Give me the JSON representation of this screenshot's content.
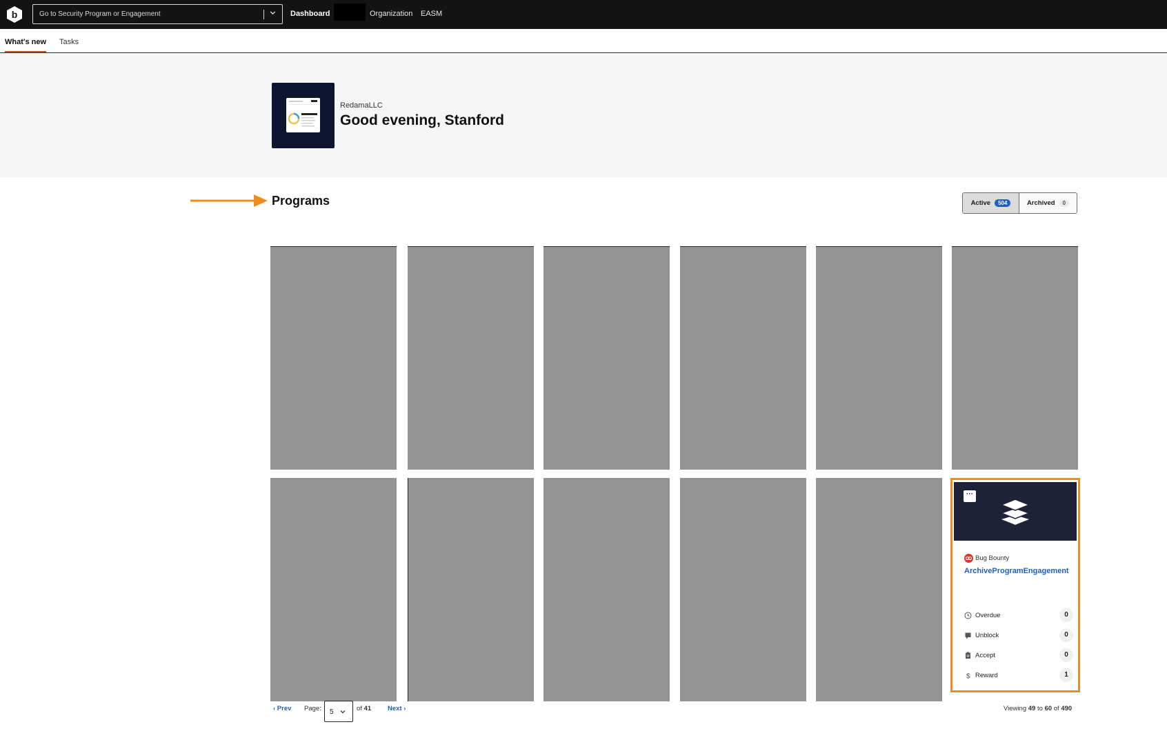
{
  "topnav": {
    "logo_letter": "b",
    "search_placeholder": "Go to Security Program or Engagement",
    "items": [
      {
        "label": "Dashboard",
        "active": true
      },
      {
        "label": "Organization",
        "active": false
      },
      {
        "label": "EASM",
        "active": false
      }
    ]
  },
  "subnav": {
    "tabs": [
      {
        "label": "What's new",
        "active": true
      },
      {
        "label": "Tasks",
        "active": false
      }
    ]
  },
  "hero": {
    "organization": "RedamaLLC",
    "greeting": "Good evening, Stanford"
  },
  "programs": {
    "title": "Programs",
    "filters": [
      {
        "label": "Active",
        "count": "504",
        "active": true
      },
      {
        "label": "Archived",
        "count": "0",
        "active": false
      }
    ],
    "highlighted_card": {
      "more_label": "···",
      "type_label": "Bug Bounty",
      "name": "ArchiveProgramEngagement",
      "metrics": [
        {
          "label": "Overdue",
          "count": "0",
          "icon": "clock-icon"
        },
        {
          "label": "Unblock",
          "count": "0",
          "icon": "unblock-icon"
        },
        {
          "label": "Accept",
          "count": "0",
          "icon": "accept-icon"
        },
        {
          "label": "Reward",
          "count": "1",
          "icon": "dollar-icon"
        }
      ]
    }
  },
  "pagination": {
    "prev_label": "‹ Prev",
    "page_label": "Page:",
    "current_page": "5",
    "of_label": "of",
    "total_pages": "41",
    "next_label": "Next ›",
    "viewing_label": "Viewing",
    "range_from": "49",
    "to_label": "to",
    "range_to": "60",
    "of2_label": "of",
    "total_items": "490"
  },
  "colors": {
    "accent_orange": "#f28b1d",
    "link_blue": "#1f5fbf",
    "topbar": "#131313",
    "redacted_card": "#949494"
  }
}
